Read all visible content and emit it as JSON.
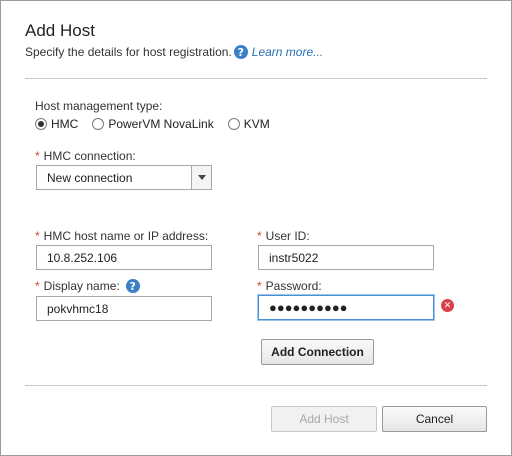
{
  "dialog": {
    "title": "Add Host",
    "subtitle": "Specify the details for host registration.",
    "learn_more": "Learn more...",
    "help_glyph": "?"
  },
  "management": {
    "label": "Host management type:",
    "options": [
      "HMC",
      "PowerVM NovaLink",
      "KVM"
    ],
    "selected": "HMC"
  },
  "connection": {
    "label": "HMC connection:",
    "value": "New connection"
  },
  "fields": {
    "host_label": "HMC host name or IP address:",
    "host_value": "10.8.252.106",
    "user_label": "User ID:",
    "user_value": "instr5022",
    "display_label": "Display name:",
    "display_value": "pokvhmc18",
    "password_label": "Password:",
    "password_value": "●●●●●●●●●●",
    "required_mark": "*"
  },
  "buttons": {
    "add_connection": "Add Connection",
    "add_host": "Add Host",
    "cancel": "Cancel"
  },
  "error_glyph": "✕"
}
